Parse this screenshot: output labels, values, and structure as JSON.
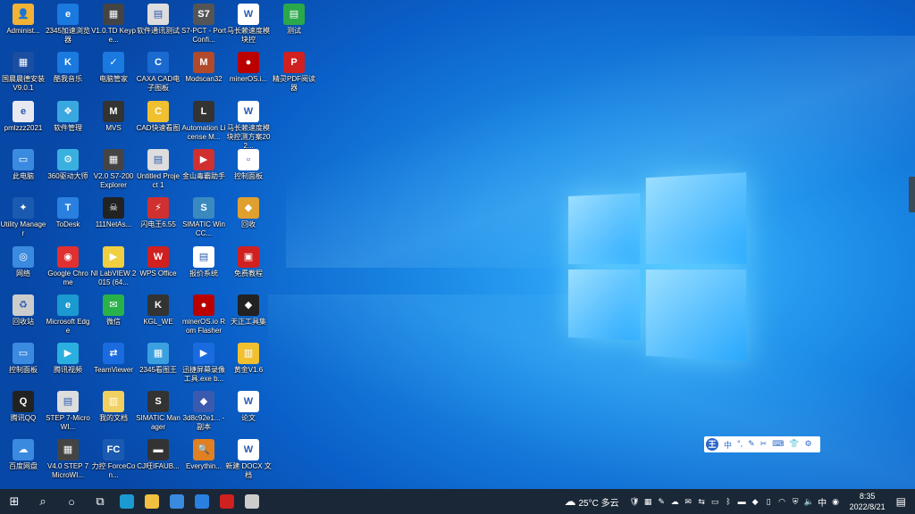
{
  "desktop": {
    "icons": [
      {
        "label": "Administ...",
        "color": "#f2b233",
        "glyph": "👤"
      },
      {
        "label": "2345加速浏览器",
        "color": "#1a7ae0",
        "glyph": "e"
      },
      {
        "label": "V1.0.TD Keype...",
        "color": "#444",
        "glyph": "▦"
      },
      {
        "label": "软件通讯测试",
        "color": "#ddd",
        "glyph": "▤"
      },
      {
        "label": "S7-PCT - Port Confi...",
        "color": "#555",
        "glyph": "S7"
      },
      {
        "label": "马长赖速度模块控",
        "color": "#fff",
        "glyph": "W"
      },
      {
        "label": "测试",
        "color": "#2aa84a",
        "glyph": "▤"
      },
      {
        "label": "国晨晨德安装V9.0.1",
        "color": "#1a4ea0",
        "glyph": "▦"
      },
      {
        "label": "酷我音乐",
        "color": "#1a7ae0",
        "glyph": "K"
      },
      {
        "label": "电脑管家",
        "color": "#1a7ae0",
        "glyph": "✓"
      },
      {
        "label": "CAXA CAD电子图板",
        "color": "#1a6ad0",
        "glyph": "C"
      },
      {
        "label": "Modscan32",
        "color": "#b04a2a",
        "glyph": "M"
      },
      {
        "label": "minerOS.i...",
        "color": "#b00",
        "glyph": "●"
      },
      {
        "label": "精灵PDF阅读器",
        "color": "#d02020",
        "glyph": "P"
      },
      {
        "label": "pmlzzz2021",
        "color": "#e8e8f0",
        "glyph": "e"
      },
      {
        "label": "软件管理",
        "color": "#3aa8e0",
        "glyph": "❖"
      },
      {
        "label": "MVS",
        "color": "#333",
        "glyph": "M"
      },
      {
        "label": "CAD快速看图",
        "color": "#f0c030",
        "glyph": "C"
      },
      {
        "label": "Automation License M...",
        "color": "#333",
        "glyph": "L"
      },
      {
        "label": "马长赖速度模块控测方案202...",
        "color": "#fff",
        "glyph": "W"
      },
      {
        "label": "此电脑",
        "color": "#3a8ae0",
        "glyph": "▭"
      },
      {
        "label": "360驱动大师",
        "color": "#3ab0e0",
        "glyph": "⚙"
      },
      {
        "label": "V2.0 S7-200 Explorer",
        "color": "#444",
        "glyph": "▦"
      },
      {
        "label": "Untitled Project 1",
        "color": "#ddd",
        "glyph": "▤"
      },
      {
        "label": "金山毒霸助手",
        "color": "#d03030",
        "glyph": "▶"
      },
      {
        "label": "控制面板",
        "color": "#fff",
        "glyph": "▫"
      },
      {
        "label": "Utility Manager",
        "color": "#1a5ab0",
        "glyph": "✦"
      },
      {
        "label": "ToDesk",
        "color": "#2a80e0",
        "glyph": "T"
      },
      {
        "label": "111NetAs...",
        "color": "#222",
        "glyph": "☠"
      },
      {
        "label": "闪电王6.55",
        "color": "#d03030",
        "glyph": "⚡"
      },
      {
        "label": "SIMATIC WinCC...",
        "color": "#3a8ac0",
        "glyph": "S"
      },
      {
        "label": "回收",
        "color": "#e0a030",
        "glyph": "◆"
      },
      {
        "label": "网络",
        "color": "#3a8ae0",
        "glyph": "◎"
      },
      {
        "label": "Google Chrome",
        "color": "#e03030",
        "glyph": "◉"
      },
      {
        "label": "NI LabVIEW 2015 (64...",
        "color": "#f0d040",
        "glyph": "▶"
      },
      {
        "label": "WPS Office",
        "color": "#d02020",
        "glyph": "W"
      },
      {
        "label": "报价系统",
        "color": "#fff",
        "glyph": "▤"
      },
      {
        "label": "免费教程",
        "color": "#d02020",
        "glyph": "▣"
      },
      {
        "label": "回收站",
        "color": "#ccc",
        "glyph": "♻"
      },
      {
        "label": "Microsoft Edge",
        "color": "#1a9ad0",
        "glyph": "e"
      },
      {
        "label": "微信",
        "color": "#2ab24a",
        "glyph": "✉"
      },
      {
        "label": "KGL_WE",
        "color": "#333",
        "glyph": "K"
      },
      {
        "label": "minerOS.io Rom Flasher",
        "color": "#b00",
        "glyph": "●"
      },
      {
        "label": "天正工具集",
        "color": "#222",
        "glyph": "◆"
      },
      {
        "label": "控制面板",
        "color": "#3a8ae0",
        "glyph": "▭"
      },
      {
        "label": "腾讯视频",
        "color": "#2ab0e0",
        "glyph": "▶"
      },
      {
        "label": "TeamViewer",
        "color": "#1a6ae0",
        "glyph": "⇄"
      },
      {
        "label": "2345看图王",
        "color": "#3aa0e0",
        "glyph": "▦"
      },
      {
        "label": "迅捷屏幕录像工具.exe b...",
        "color": "#1a6ae0",
        "glyph": "▶"
      },
      {
        "label": "黄金V1.6",
        "color": "#f0c030",
        "glyph": "▥"
      },
      {
        "label": "腾讯QQ",
        "color": "#222",
        "glyph": "Q"
      },
      {
        "label": "STEP 7-MicroWI...",
        "color": "#ddd",
        "glyph": "▤"
      },
      {
        "label": "我的文档",
        "color": "#f0d060",
        "glyph": "▥"
      },
      {
        "label": "SIMATIC Manager",
        "color": "#333",
        "glyph": "S"
      },
      {
        "label": "3d8c92e1... - 副本",
        "color": "#3a5ab0",
        "glyph": "◆"
      },
      {
        "label": "论文",
        "color": "#fff",
        "glyph": "W"
      },
      {
        "label": "百度网盘",
        "color": "#3a8ae0",
        "glyph": "☁"
      },
      {
        "label": "V4.0 STEP 7 MicroWI...",
        "color": "#444",
        "glyph": "▦"
      },
      {
        "label": "力控 ForceCon...",
        "color": "#1a5ab0",
        "glyph": "FC"
      },
      {
        "label": "CJ旺IFAUB...",
        "color": "#333",
        "glyph": "▬"
      },
      {
        "label": "Everythin...",
        "color": "#e08020",
        "glyph": "🔍"
      },
      {
        "label": "新建 DOCX 文档",
        "color": "#fff",
        "glyph": "W"
      }
    ]
  },
  "ime": {
    "logo": "王",
    "items": [
      "中",
      "°,",
      "✎",
      "✂",
      "⌨",
      "👕",
      "⚙"
    ]
  },
  "taskbar": {
    "start_glyph": "⊞",
    "search_glyph": "⌕",
    "cortana_glyph": "○",
    "taskview_glyph": "⧉",
    "apps": [
      {
        "name": "edge",
        "color": "#1a9ad0"
      },
      {
        "name": "file-explorer",
        "color": "#f0c040"
      },
      {
        "name": "store",
        "color": "#3a8ae0"
      },
      {
        "name": "ie",
        "color": "#2a80e0"
      },
      {
        "name": "wps",
        "color": "#d02020"
      },
      {
        "name": "app-window",
        "color": "#ccc"
      }
    ],
    "weather": "25°C 多云",
    "ime_indicator": "中",
    "time": "8:35",
    "date": "2022/8/21"
  }
}
